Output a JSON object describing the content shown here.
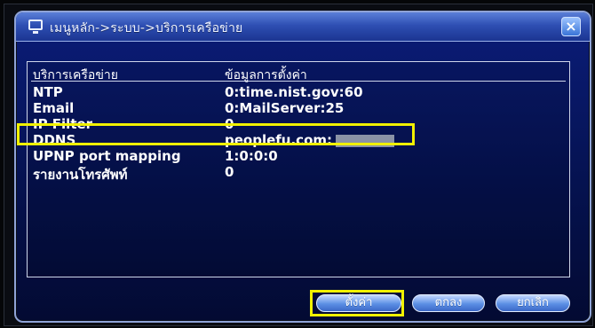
{
  "title": {
    "breadcrumb": "เมนูหลัก->ระบบ->บริการเครือข่าย",
    "close_symbol": "×"
  },
  "table": {
    "header": {
      "left": "บริการเครือข่าย",
      "right": "ข้อมูลการตั้งค่า"
    },
    "rows": [
      {
        "name": "NTP",
        "value": "0:time.nist.gov:60"
      },
      {
        "name": "Email",
        "value": "0:MailServer:25"
      },
      {
        "name": "IP Filter",
        "value": "0"
      },
      {
        "name": "DDNS",
        "value": "peoplefu.com:"
      },
      {
        "name": "UPNP port mapping",
        "value": "1:0:0:0"
      },
      {
        "name": "รายงานโทรศัพท์",
        "value": "0"
      }
    ]
  },
  "buttons": {
    "setup": "ตั้งค่า",
    "ok": "ตกลง",
    "cancel": "ยกเลิก"
  },
  "colors": {
    "highlight": "#f1f100",
    "window_blue": "#0b1d7a",
    "titlebar_blue": "#2e4fb3"
  },
  "icons": {
    "title_icon": "monitor-icon",
    "close_icon": "close-icon"
  }
}
